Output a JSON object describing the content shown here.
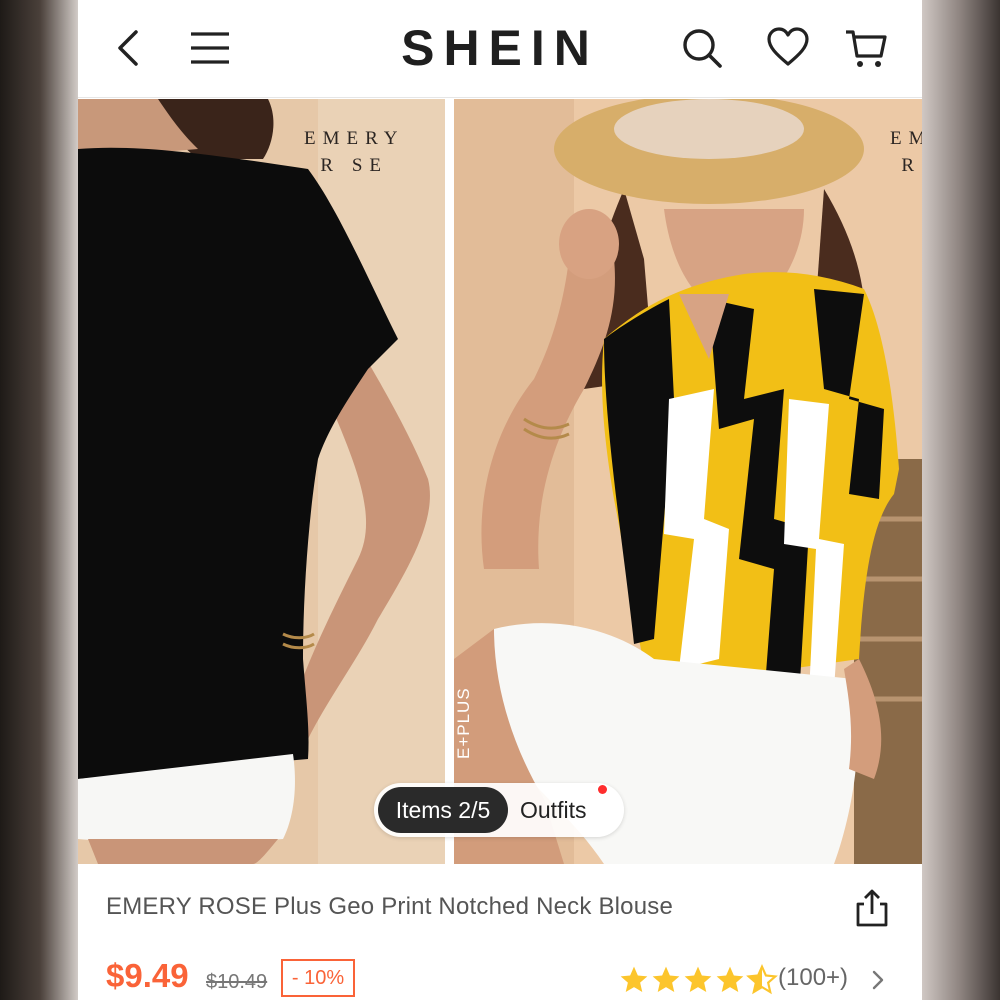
{
  "header": {
    "brand": "SHEIN",
    "icons": [
      "back-arrow-icon",
      "menu-icon",
      "search-icon",
      "heart-icon",
      "cart-icon"
    ]
  },
  "gallery": {
    "watermark_left_line1": "EMERY",
    "watermark_left_line2": "R  SE",
    "watermark_right_line1": "EM",
    "watermark_right_line2": "R",
    "side_text": "E+PLUS",
    "items_label": "Items 2/5",
    "outfits_label": "Outfits"
  },
  "product": {
    "title": "EMERY ROSE Plus Geo Print Notched Neck Blouse",
    "price": "$9.49",
    "original_price": "$10.49",
    "discount": "- 10%",
    "rating": 4.5,
    "review_count": "(100+)"
  },
  "colors": {
    "price": "#fa6338",
    "star": "#fcc52c",
    "notification_dot": "#ff2d2d"
  }
}
